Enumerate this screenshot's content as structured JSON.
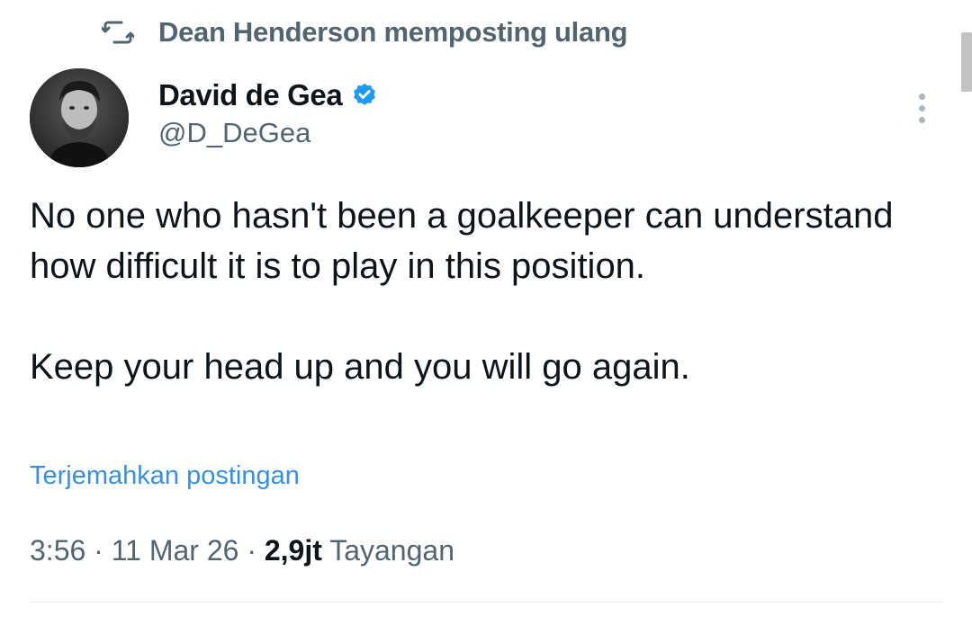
{
  "repost": {
    "icon": "repost-icon",
    "text": "Dean Henderson memposting ulang"
  },
  "author": {
    "name": "David de Gea",
    "handle": "@D_DeGea",
    "verified_icon": "verified-badge-icon",
    "verified_color": "#1d9bf0"
  },
  "tweet": {
    "line1": "No one who hasn't been a goalkeeper can understand how difficult it is to play in this position.",
    "line2": "Keep your head up and you will go again.",
    "translate_label": "Terjemahkan postingan"
  },
  "meta": {
    "time": "3:56",
    "separator": " · ",
    "date": "11 Mar 26",
    "views_count": "2,9jt",
    "views_label": "Tayangan"
  },
  "colors": {
    "text_primary": "#0f1419",
    "text_secondary": "#536471",
    "link": "#3b8fd9",
    "divider": "#e6ecf0"
  }
}
